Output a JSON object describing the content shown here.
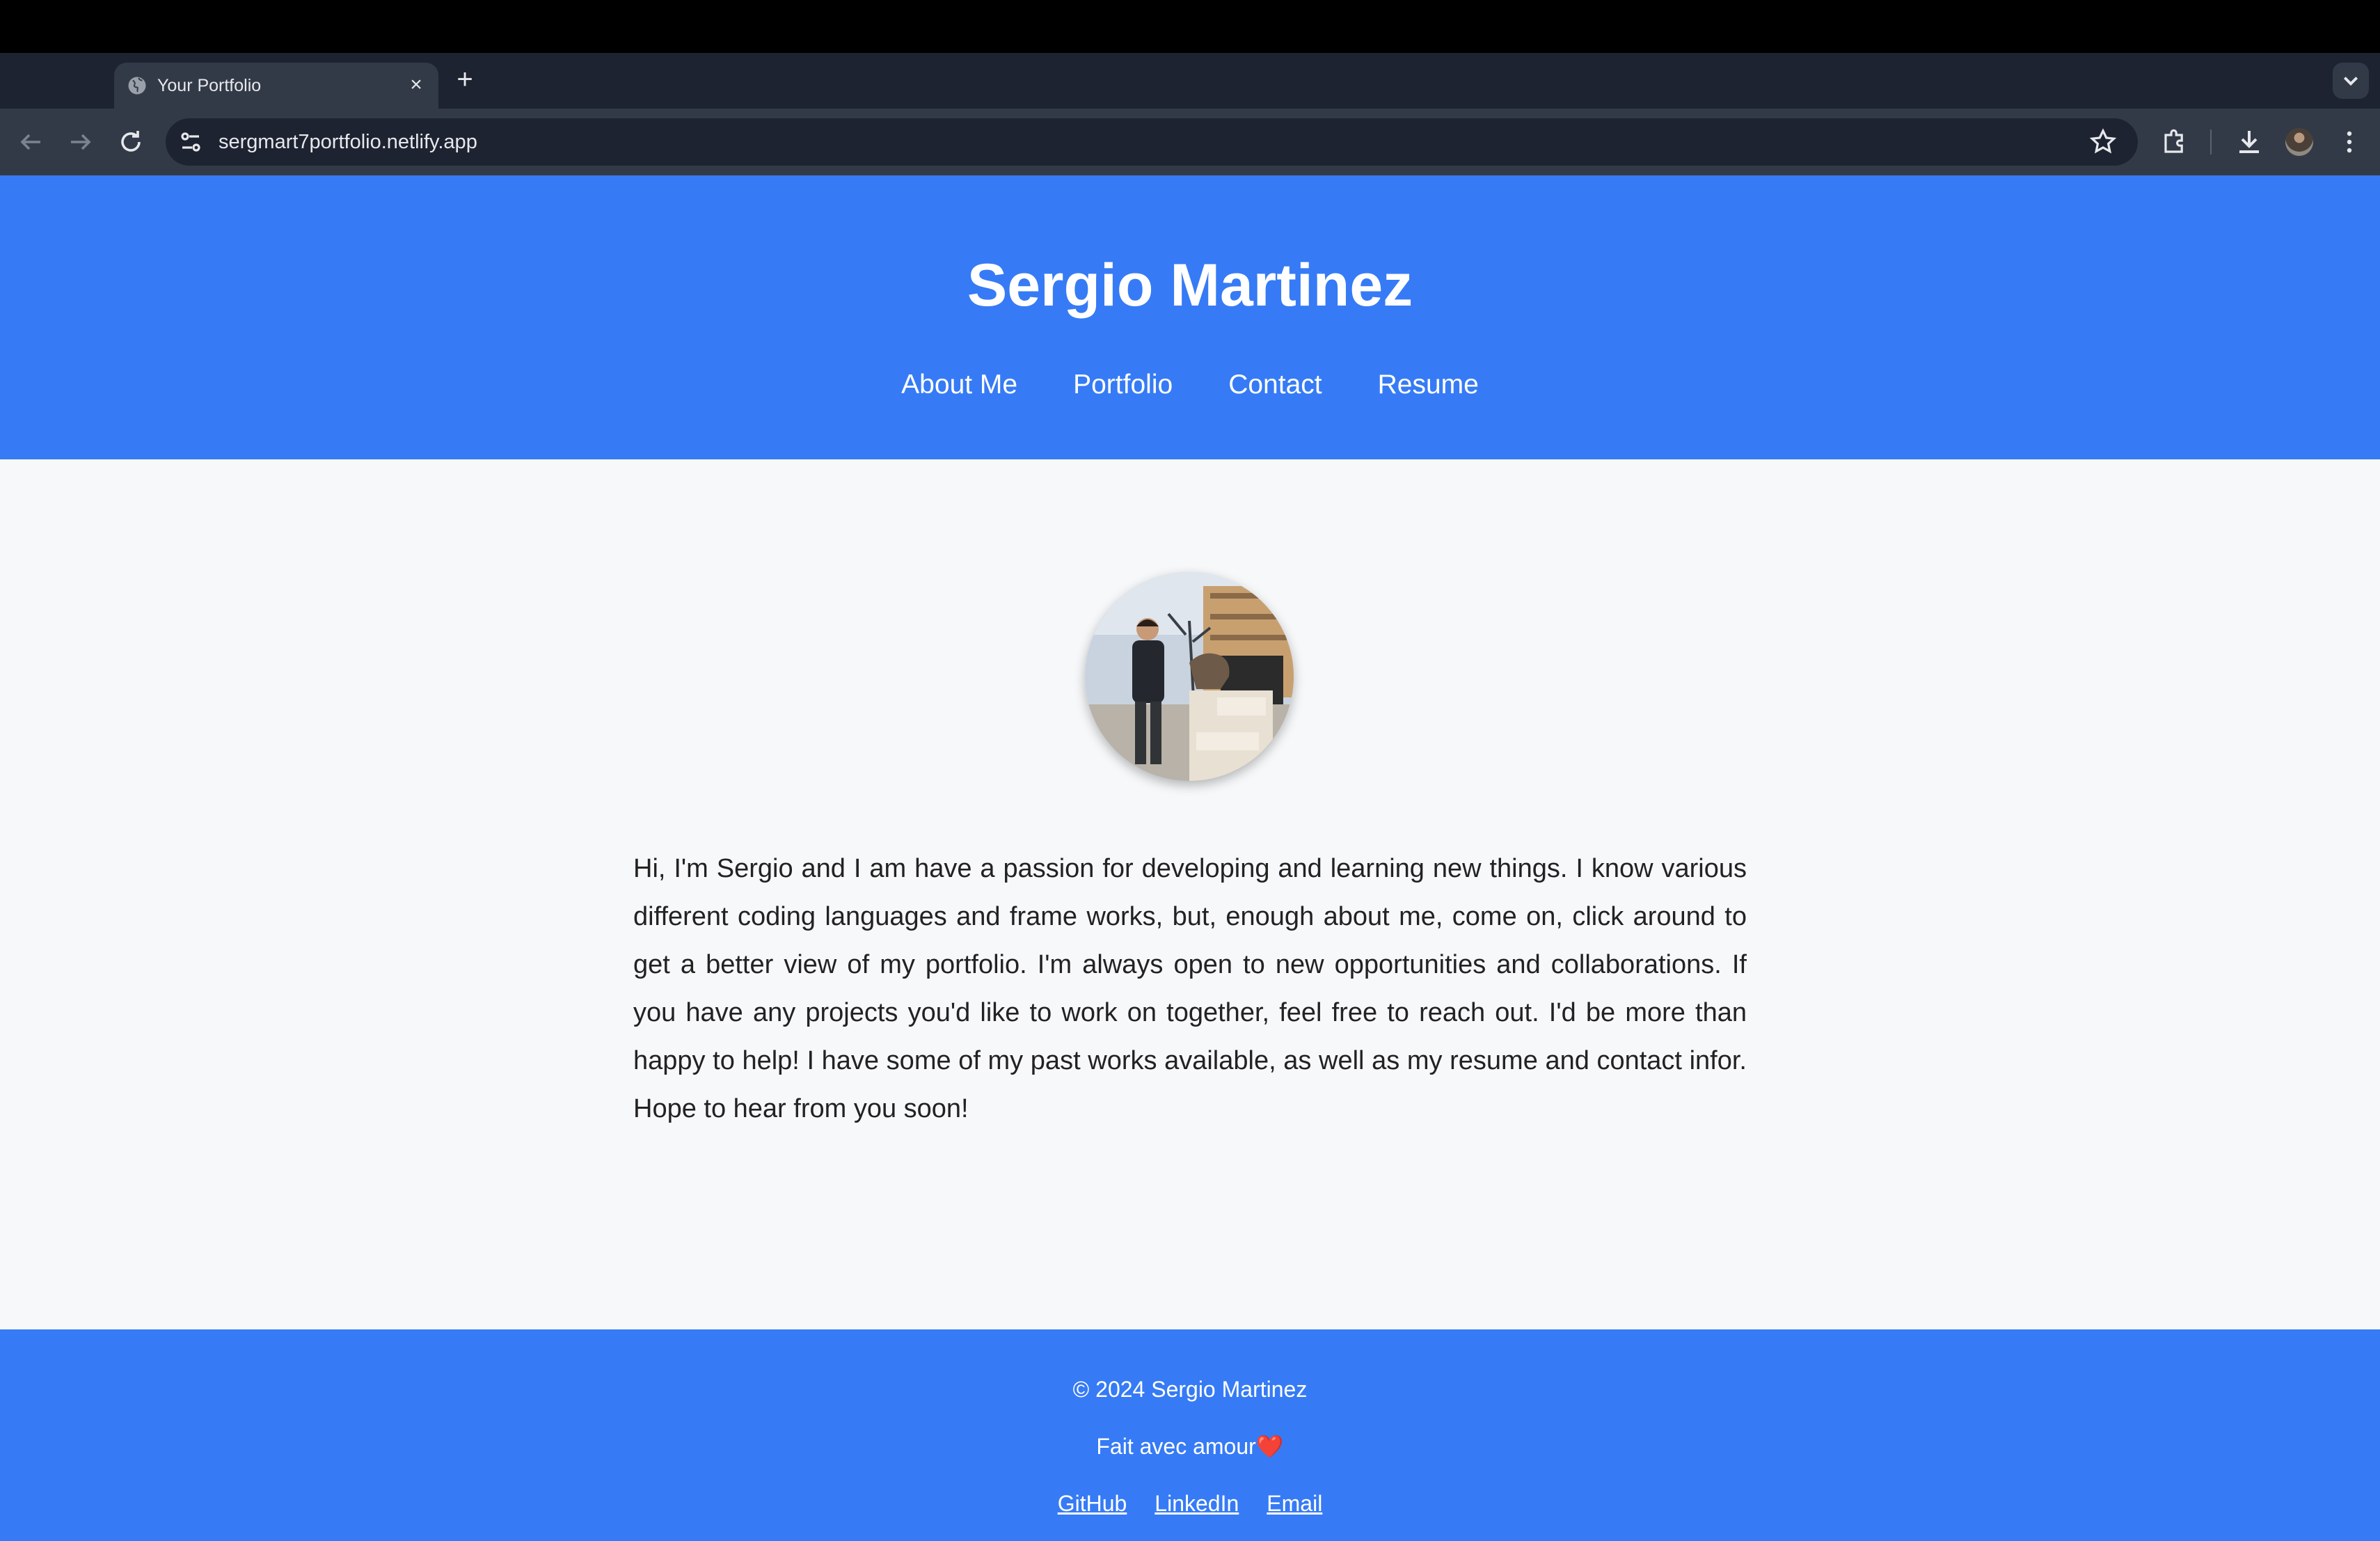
{
  "browser": {
    "tab_title": "Your Portfolio",
    "tab_close": "×",
    "new_tab": "+",
    "url": "sergmart7portfolio.netlify.app"
  },
  "header": {
    "title": "Sergio Martinez",
    "nav": [
      "About Me",
      "Portfolio",
      "Contact",
      "Resume"
    ]
  },
  "about": {
    "text": "Hi, I'm Sergio and I am have a passion for developing and learning new things. I know various different coding languages and frame works, but, enough about me, come on, click around to get a better view of my portfolio. I'm always open to new opportunities and collaborations. If you have any projects you'd like to work on together, feel free to reach out. I'd be more than happy to help! I have some of my past works available, as well as my resume and contact infor. Hope to hear from you soon!"
  },
  "footer": {
    "copyright": "© 2024 Sergio Martinez",
    "made_with": "Fait avec amour",
    "heart": "❤️",
    "links": [
      "GitHub",
      "LinkedIn",
      "Email"
    ]
  },
  "colors": {
    "brand_blue": "#367bf5",
    "page_bg": "#f7f8fa",
    "browser_dark": "#1d2330",
    "browser_toolbar": "#333a47"
  },
  "icons": {
    "tab": "globe-icon",
    "toolbar": [
      "back-arrow-icon",
      "forward-arrow-icon",
      "reload-icon",
      "site-settings-icon",
      "bookmark-star-icon",
      "extensions-puzzle-icon",
      "download-icon",
      "profile-avatar",
      "more-vertical-icon"
    ]
  }
}
